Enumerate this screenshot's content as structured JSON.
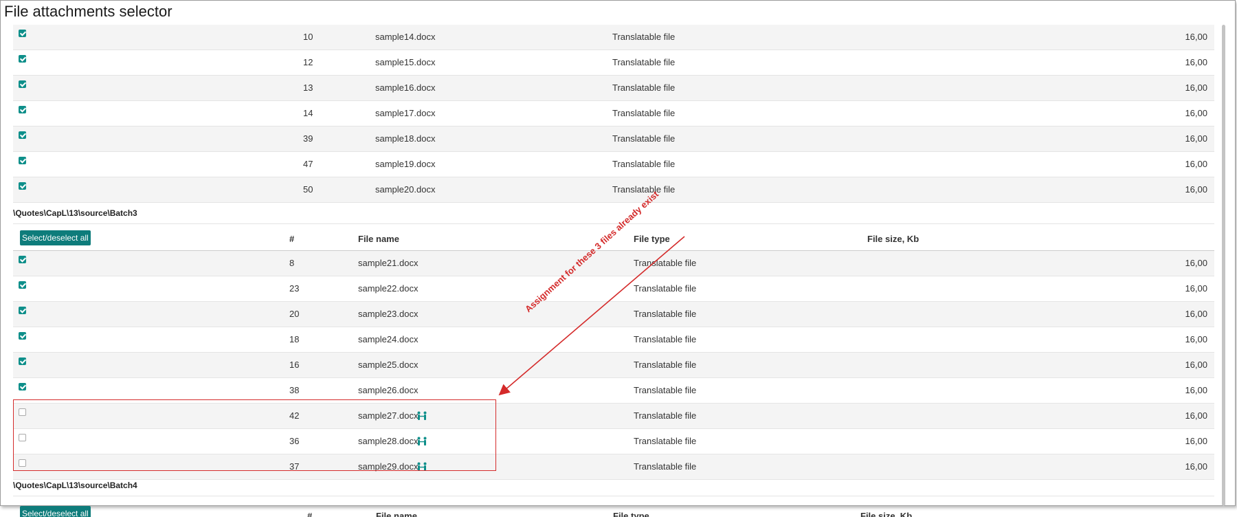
{
  "window": {
    "title": "File attachments selector"
  },
  "colors": {
    "accent": "#0e8f8a",
    "button": "#0e7c7b",
    "annotation": "#d42a2a"
  },
  "batch2_rows": [
    {
      "checked": true,
      "num": "10",
      "name": "sample14.docx",
      "type": "Translatable file",
      "size": "16,00"
    },
    {
      "checked": true,
      "num": "12",
      "name": "sample15.docx",
      "type": "Translatable file",
      "size": "16,00"
    },
    {
      "checked": true,
      "num": "13",
      "name": "sample16.docx",
      "type": "Translatable file",
      "size": "16,00"
    },
    {
      "checked": true,
      "num": "14",
      "name": "sample17.docx",
      "type": "Translatable file",
      "size": "16,00"
    },
    {
      "checked": true,
      "num": "39",
      "name": "sample18.docx",
      "type": "Translatable file",
      "size": "16,00"
    },
    {
      "checked": true,
      "num": "47",
      "name": "sample19.docx",
      "type": "Translatable file",
      "size": "16,00"
    },
    {
      "checked": true,
      "num": "50",
      "name": "sample20.docx",
      "type": "Translatable file",
      "size": "16,00"
    }
  ],
  "batch3": {
    "path": "\\Quotes\\CapL\\13\\source\\Batch3",
    "select_all": "Select/deselect all",
    "headers": {
      "num": "#",
      "name": "File name",
      "type": "File type",
      "size": "File size, Kb"
    },
    "rows": [
      {
        "checked": true,
        "num": "8",
        "name": "sample21.docx",
        "type": "Translatable file",
        "size": "16,00",
        "assigned": false
      },
      {
        "checked": true,
        "num": "23",
        "name": "sample22.docx",
        "type": "Translatable file",
        "size": "16,00",
        "assigned": false
      },
      {
        "checked": true,
        "num": "20",
        "name": "sample23.docx",
        "type": "Translatable file",
        "size": "16,00",
        "assigned": false
      },
      {
        "checked": true,
        "num": "18",
        "name": "sample24.docx",
        "type": "Translatable file",
        "size": "16,00",
        "assigned": false
      },
      {
        "checked": true,
        "num": "16",
        "name": "sample25.docx",
        "type": "Translatable file",
        "size": "16,00",
        "assigned": false
      },
      {
        "checked": true,
        "num": "38",
        "name": "sample26.docx",
        "type": "Translatable file",
        "size": "16,00",
        "assigned": false
      },
      {
        "checked": false,
        "num": "42",
        "name": "sample27.docx",
        "type": "Translatable file",
        "size": "16,00",
        "assigned": true
      },
      {
        "checked": false,
        "num": "36",
        "name": "sample28.docx",
        "type": "Translatable file",
        "size": "16,00",
        "assigned": true
      },
      {
        "checked": false,
        "num": "37",
        "name": "sample29.docx",
        "type": "Translatable file",
        "size": "16,00",
        "assigned": true
      }
    ]
  },
  "batch4": {
    "path": "\\Quotes\\CapL\\13\\source\\Batch4",
    "select_all": "Select/deselect all",
    "headers": {
      "num": "#",
      "name": "File name",
      "type": "File type",
      "size": "File size, Kb"
    }
  },
  "annotation": {
    "text": "Assignment for these 3 files already exist"
  },
  "icons": {
    "assignment": "people-assignment-icon",
    "checkbox": "checkbox-icon"
  }
}
